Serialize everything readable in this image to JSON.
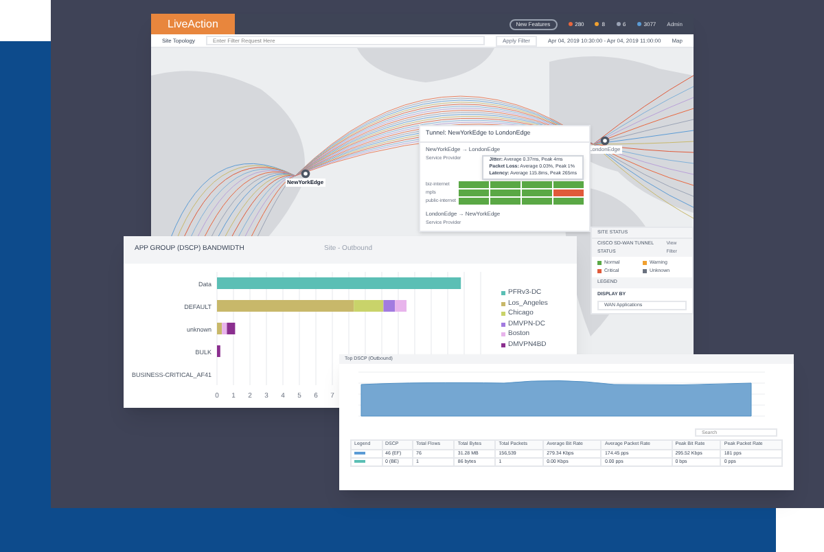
{
  "app": {
    "logo": "LiveAction",
    "new_features": "New Features",
    "counters": [
      {
        "count": "280",
        "color": "#e8663d"
      },
      {
        "count": "8",
        "color": "#f0a030"
      },
      {
        "count": "6",
        "color": "#9aa3b5"
      },
      {
        "count": "3077",
        "color": "#5b9bd5"
      }
    ],
    "user": "Admin"
  },
  "toolbar": {
    "title": "Site Topology",
    "filter_placeholder": "Enter Filter Request Here",
    "apply": "Apply Filter",
    "time_range": "Apr 04, 2019 10:30:00 - Apr 04, 2019 11:00:00",
    "view": "Map"
  },
  "map": {
    "nodes": [
      {
        "label": "NewYorkEdge",
        "selected": true
      },
      {
        "label": "LondonEdge",
        "selected": false
      }
    ]
  },
  "tunnel_popup": {
    "title": "Tunnel: NewYorkEdge to LondonEdge",
    "directions": [
      {
        "label": "NewYorkEdge → LondonEdge",
        "header": "Service Provider",
        "rows": [
          {
            "label": "biz-internet",
            "cells": [
              {
                "color": "#5aa845"
              },
              {
                "color": "#5aa845"
              },
              {
                "color": "#5aa845"
              },
              {
                "color": "#5aa845"
              }
            ]
          },
          {
            "label": "mpls",
            "cells": [
              {
                "color": "#5aa845"
              },
              {
                "color": "#5aa845"
              },
              {
                "color": "#5aa845"
              },
              {
                "color": "#e05a3a"
              }
            ]
          },
          {
            "label": "public-internet",
            "cells": [
              {
                "color": "#5aa845"
              },
              {
                "color": "#5aa845"
              },
              {
                "color": "#5aa845"
              },
              {
                "color": "#5aa845"
              }
            ]
          }
        ]
      },
      {
        "label": "LondonEdge → NewYorkEdge",
        "header": "Service Provider"
      }
    ],
    "tooltip": [
      "**Jitter:** Average 0.37ms, Peak 4ms",
      "**Packet Loss:** Average 0.03%, Peak 1%",
      "**Latency:** Average 115.8ms, Peak 265ms"
    ]
  },
  "side_panel": {
    "site_status": "SITE STATUS",
    "tunnel_status": "CISCO SD-WAN TUNNEL STATUS",
    "view_filter": "View Filter",
    "statuses": [
      {
        "label": "Normal",
        "color": "#5aa845"
      },
      {
        "label": "Warning",
        "color": "#f0a030"
      },
      {
        "label": "Critical",
        "color": "#e05a3a"
      },
      {
        "label": "Unknown",
        "color": "#6b7280"
      }
    ],
    "legend": "LEGEND",
    "display_by": "DISPLAY BY",
    "display_value": "WAN Applications"
  },
  "bandwidth_card": {
    "title": "APP GROUP (DSCP) BANDWIDTH",
    "subtitle": "Site - Outbound",
    "chart_data": {
      "type": "bar",
      "orientation": "horizontal",
      "stacked": true,
      "categories": [
        "Data",
        "DEFAULT",
        "unknown",
        "BULK",
        "BUSINESS-CRITICAL_AF41"
      ],
      "xlim": [
        0,
        16
      ],
      "xticks": [
        0,
        1,
        2,
        3,
        4,
        5,
        6,
        7
      ],
      "grid": true,
      "legend": true,
      "series": [
        {
          "name": "PFRv3-DC",
          "color": "#5bbfb5",
          "values": [
            14.8,
            0,
            0,
            0,
            0
          ]
        },
        {
          "name": "Los_Angeles",
          "color": "#c8b86a",
          "values": [
            0,
            8.3,
            0.3,
            0,
            0
          ]
        },
        {
          "name": "Chicago",
          "color": "#c9d36a",
          "values": [
            0,
            1.8,
            0,
            0,
            0
          ]
        },
        {
          "name": "DMVPN-DC",
          "color": "#a27be0",
          "values": [
            0,
            0.7,
            0,
            0,
            0
          ]
        },
        {
          "name": "Boston",
          "color": "#e8b4ec",
          "values": [
            0,
            0.7,
            0.3,
            0,
            0
          ]
        },
        {
          "name": "DMVPN4BD",
          "color": "#8b2f8f",
          "values": [
            0,
            0,
            0.5,
            0.2,
            0
          ]
        }
      ]
    }
  },
  "dscp_card": {
    "title": "Top DSCP (Outbound)",
    "search_placeholder": "Search",
    "columns": [
      "Legend",
      "DSCP",
      "Total Flows",
      "Total Bytes",
      "Total Packets",
      "Average Bit Rate",
      "Average Packet Rate",
      "Peak Bit Rate",
      "Peak Packet Rate"
    ],
    "rows": [
      {
        "color": "#5b9bd5",
        "cells": [
          "",
          "46 (EF)",
          "76",
          "31.28 MB",
          "156,539",
          "279.34 Kbps",
          "174.45 pps",
          "295.52 Kbps",
          "181 pps"
        ]
      },
      {
        "color": "#5bbfb5",
        "cells": [
          "",
          "0 (BE)",
          "1",
          "86 bytes",
          "1",
          "0.00 Kbps",
          "0.00 pps",
          "0 bps",
          "0 pps"
        ]
      }
    ]
  }
}
